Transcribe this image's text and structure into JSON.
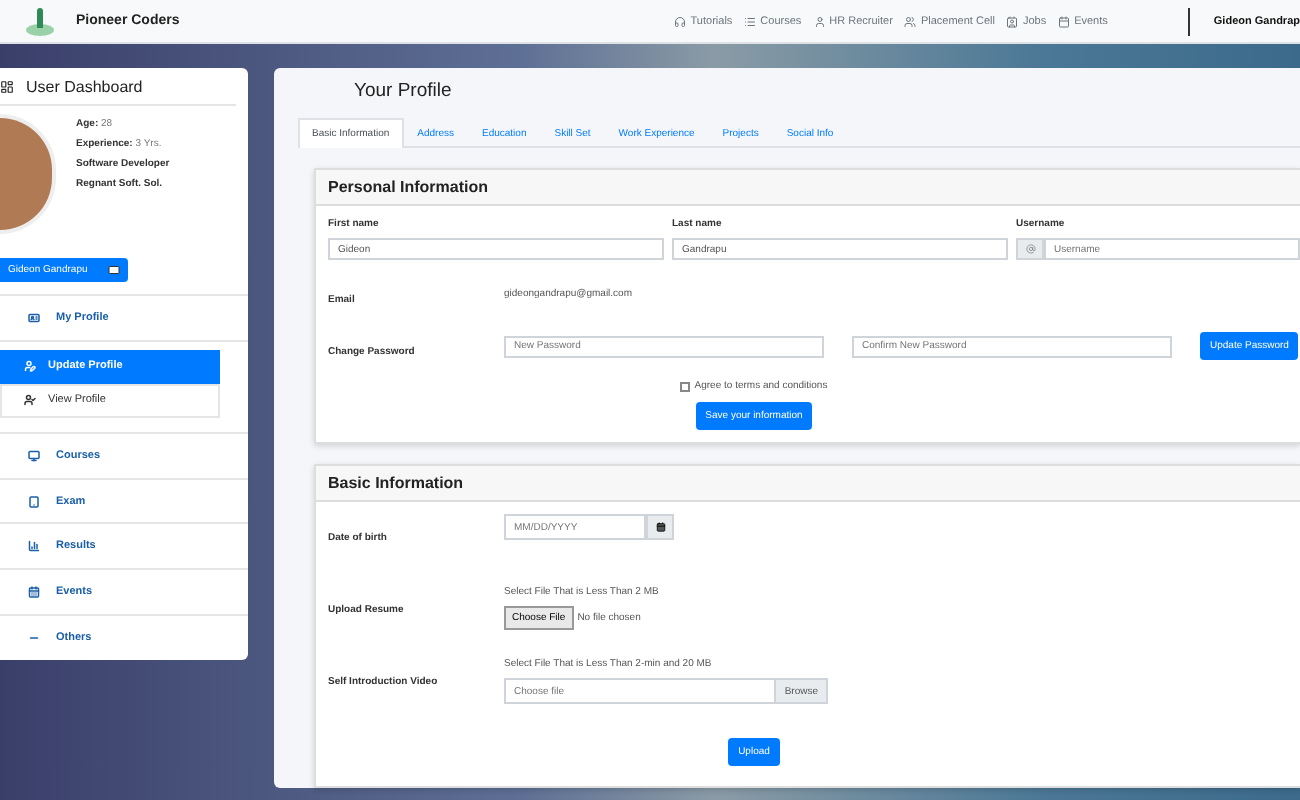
{
  "header": {
    "brand": "Pioneer Coders",
    "nav": [
      {
        "kind": "headset",
        "label": "Tutorials"
      },
      {
        "kind": "list",
        "label": "Courses"
      },
      {
        "kind": "user",
        "label": "HR Recruiter"
      },
      {
        "kind": "users",
        "label": "Placement Cell"
      },
      {
        "kind": "userTie",
        "label": "Jobs"
      },
      {
        "kind": "calendar",
        "label": "Events"
      }
    ],
    "user": "Gideon Gandrap"
  },
  "sidebar": {
    "title": "User Dashboard",
    "info": [
      {
        "label": "Age:",
        "value": "28"
      },
      {
        "label": "Experience:",
        "value": "3 Yrs."
      },
      {
        "value": "Software Developer"
      },
      {
        "value": "Regnant Soft. Sol."
      }
    ],
    "name_button": "Gideon Gandrapu",
    "menu": [
      {
        "kind": "idcard",
        "label": "My Profile",
        "children": [
          {
            "kind": "userEdit",
            "label": "Update Profile",
            "selected": true
          },
          {
            "kind": "userCheck",
            "label": "View Profile",
            "selected": false
          }
        ]
      },
      {
        "kind": "monitor",
        "label": "Courses"
      },
      {
        "kind": "tablet",
        "label": "Exam"
      },
      {
        "kind": "chart",
        "label": "Results"
      },
      {
        "kind": "calendar",
        "label": "Events"
      },
      {
        "kind": "bar",
        "label": "Others"
      }
    ]
  },
  "main": {
    "title": "Your Profile",
    "tabs": [
      {
        "label": "Basic Information",
        "selected": true
      },
      {
        "label": "Address",
        "selected": false
      },
      {
        "label": "Education",
        "selected": false
      },
      {
        "label": "Skill Set",
        "selected": false
      },
      {
        "label": "Work Experience",
        "selected": false
      },
      {
        "label": "Projects",
        "selected": false
      },
      {
        "label": "Social Info",
        "selected": false
      }
    ],
    "personal": {
      "title": "Personal Information",
      "first_name": {
        "label": "First name",
        "value": "Gideon"
      },
      "last_name": {
        "label": "Last name",
        "value": "Gandrapu"
      },
      "username": {
        "label": "Username",
        "placeholder": "Username"
      },
      "email": {
        "label": "Email",
        "value": "gideongandrapu@gmail.com"
      },
      "password": {
        "label": "Change Password",
        "new_placeholder": "New Password",
        "confirm_placeholder": "Confirm New Password",
        "button": "Update Password"
      },
      "agree": {
        "label": "Agree to terms and conditions",
        "checked": false
      },
      "save_button": "Save your information"
    },
    "basic": {
      "title": "Basic Information",
      "dob": {
        "label": "Date of birth",
        "placeholder": "MM/DD/YYYY"
      },
      "resume": {
        "label": "Upload Resume",
        "hint": "Select File That is Less Than 2 MB",
        "button": "Choose File",
        "status": "No file chosen"
      },
      "video": {
        "label": "Self Introduction Video",
        "hint": "Select File That is Less Than 2-min and 20 MB",
        "placeholder": "Choose file",
        "button": "Browse"
      },
      "upload_button": "Upload"
    }
  }
}
